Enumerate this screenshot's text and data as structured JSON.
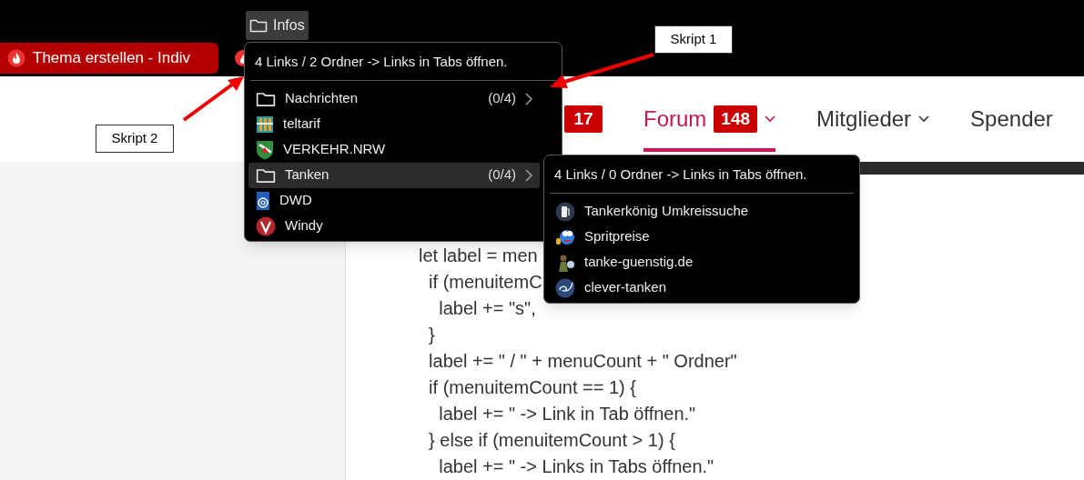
{
  "bookmarks_bar": {
    "folder": {
      "label": "Infos"
    }
  },
  "tabs": [
    {
      "title": "Thema erstellen - Indiv"
    }
  ],
  "nav": {
    "badge": "17",
    "items": [
      {
        "label": "Forum",
        "badge": "148",
        "dropdown": true,
        "selected": true
      },
      {
        "label": "Mitglieder",
        "dropdown": true,
        "selected": false
      },
      {
        "label": "Spender",
        "dropdown": false,
        "selected": false
      }
    ]
  },
  "code_lines": [
    "let label = men",
    "  if (menuitemC",
    "    label += \"s\",",
    "  }",
    "  label += \" / \" + menuCount + \" Ordner\"",
    "  if (menuitemCount == 1) {",
    "    label += \" -> Link in Tab öffnen.\"",
    "  } else if (menuitemCount > 1) {",
    "    label += \" -> Links in Tabs öffnen.\""
  ],
  "menu": {
    "header": "4 Links / 2 Ordner -> Links in Tabs öffnen.",
    "items": [
      {
        "kind": "folder",
        "label": "Nachrichten",
        "count": "(0/4)",
        "highlighted": false
      },
      {
        "kind": "link",
        "label": "teltarif",
        "highlighted": false
      },
      {
        "kind": "link",
        "label": "VERKEHR.NRW",
        "highlighted": false
      },
      {
        "kind": "folder",
        "label": "Tanken",
        "count": "(0/4)",
        "highlighted": true
      },
      {
        "kind": "link",
        "label": "DWD",
        "highlighted": false
      },
      {
        "kind": "link",
        "label": "Windy",
        "highlighted": false
      }
    ]
  },
  "submenu": {
    "header": "4 Links / 0 Ordner -> Links in Tabs öffnen.",
    "items": [
      {
        "label": "Tankerkönig Umkreissuche"
      },
      {
        "label": "Spritpreise"
      },
      {
        "label": "tanke-guenstig.de"
      },
      {
        "label": "clever-tanken"
      }
    ]
  },
  "annotations": [
    {
      "label": "Skript 1"
    },
    {
      "label": "Skript 2"
    }
  ]
}
